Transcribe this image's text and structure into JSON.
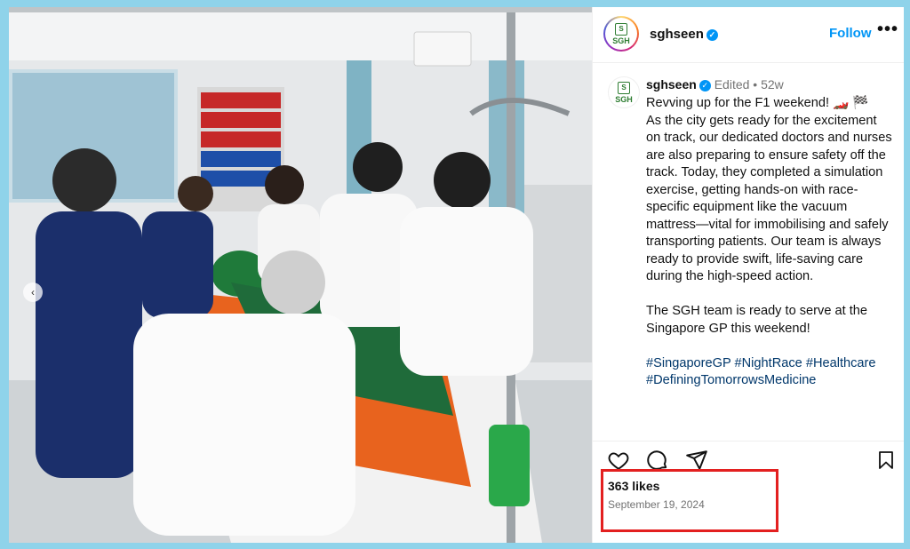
{
  "post": {
    "username": "sghseen",
    "follow_label": "Follow",
    "more_label": "•••",
    "edited_label": "Edited",
    "dot": "•",
    "age": "52w",
    "avatar_logo_text": "SGH",
    "caption_paragraph_1": "Revving up for the F1 weekend! 🏎️ 🏁\nAs the city gets ready for the excitement on track, our dedicated doctors and nurses are also preparing to ensure safety off the track. Today, they completed a simulation exercise, getting hands-on with race-specific equipment like the vacuum mattress—vital for immobilising and safely transporting patients. Our team is always ready to provide swift, life-saving care during the high-speed action.",
    "caption_paragraph_2": "The SGH team is ready to serve at the Singapore GP this weekend!",
    "hashtags": "#SingaporeGP #NightRace #Healthcare #DefiningTomorrowsMedicine",
    "likes": "363 likes",
    "date": "September 19, 2024"
  },
  "icons": {
    "like": "heart-icon",
    "comment": "comment-icon",
    "share": "send-icon",
    "save": "bookmark-icon",
    "verified": "verified-badge-icon",
    "more": "more-options-icon"
  },
  "colors": {
    "accent": "#0095f6",
    "highlight": "#e32020",
    "background": "#8fd3ea"
  }
}
